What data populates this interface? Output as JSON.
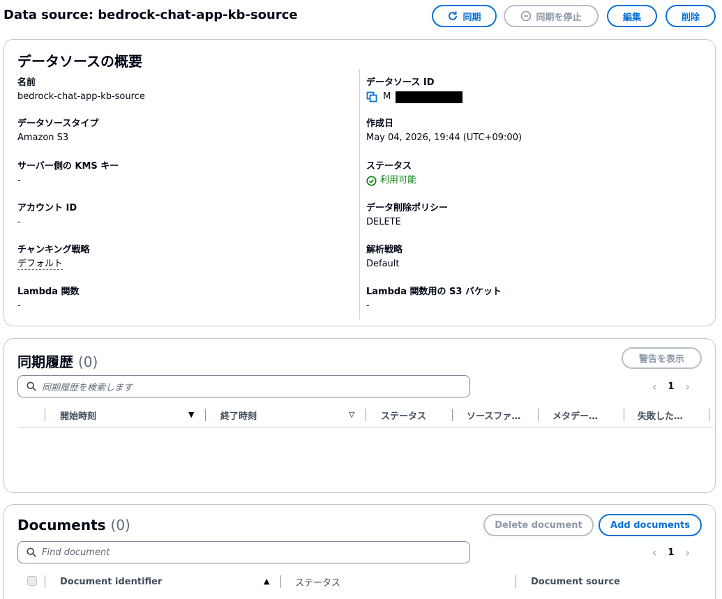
{
  "header": {
    "title": "Data source: bedrock-chat-app-kb-source",
    "sync_label": "同期",
    "stop_sync_label": "同期を停止",
    "edit_label": "編集",
    "delete_label": "削除"
  },
  "overview": {
    "title": "データソースの概要",
    "left": [
      {
        "key": "名前",
        "value": "bedrock-chat-app-kb-source"
      },
      {
        "key": "データソースタイプ",
        "value": "Amazon S3"
      },
      {
        "key": "サーバー側の KMS キー",
        "value": "-"
      },
      {
        "key": "アカウント ID",
        "value": "-"
      },
      {
        "key": "チャンキング戦略",
        "value": "デフォルト"
      },
      {
        "key": "Lambda 関数",
        "value": "-"
      }
    ],
    "right": [
      {
        "key": "データソース ID",
        "value": "M"
      },
      {
        "key": "作成日",
        "value": "May 04, 2026, 19:44 (UTC+09:00)"
      },
      {
        "key": "ステータス",
        "value": "利用可能"
      },
      {
        "key": "データ削除ポリシー",
        "value": "DELETE"
      },
      {
        "key": "解析戦略",
        "value": "Default"
      },
      {
        "key": "Lambda 関数用の S3 バケット",
        "value": "-"
      }
    ]
  },
  "sync_history": {
    "title": "同期履歴",
    "count": "(0)",
    "show_warnings_label": "警告を表示",
    "search_placeholder": "同期履歴を検索します",
    "page": "1",
    "columns": [
      "開始時刻",
      "終了時刻",
      "ステータス",
      "ソースファ…",
      "メタデー…",
      "失敗した…"
    ]
  },
  "documents": {
    "title": "Documents",
    "count": "(0)",
    "delete_label": "Delete document",
    "add_label": "Add documents",
    "search_placeholder": "Find document",
    "page": "1",
    "columns": [
      "Document identifier",
      "ステータス",
      "Document source"
    ]
  },
  "colors": {
    "primary": "#0972d3",
    "success": "#037f0c",
    "disabled": "#8d99a8"
  }
}
